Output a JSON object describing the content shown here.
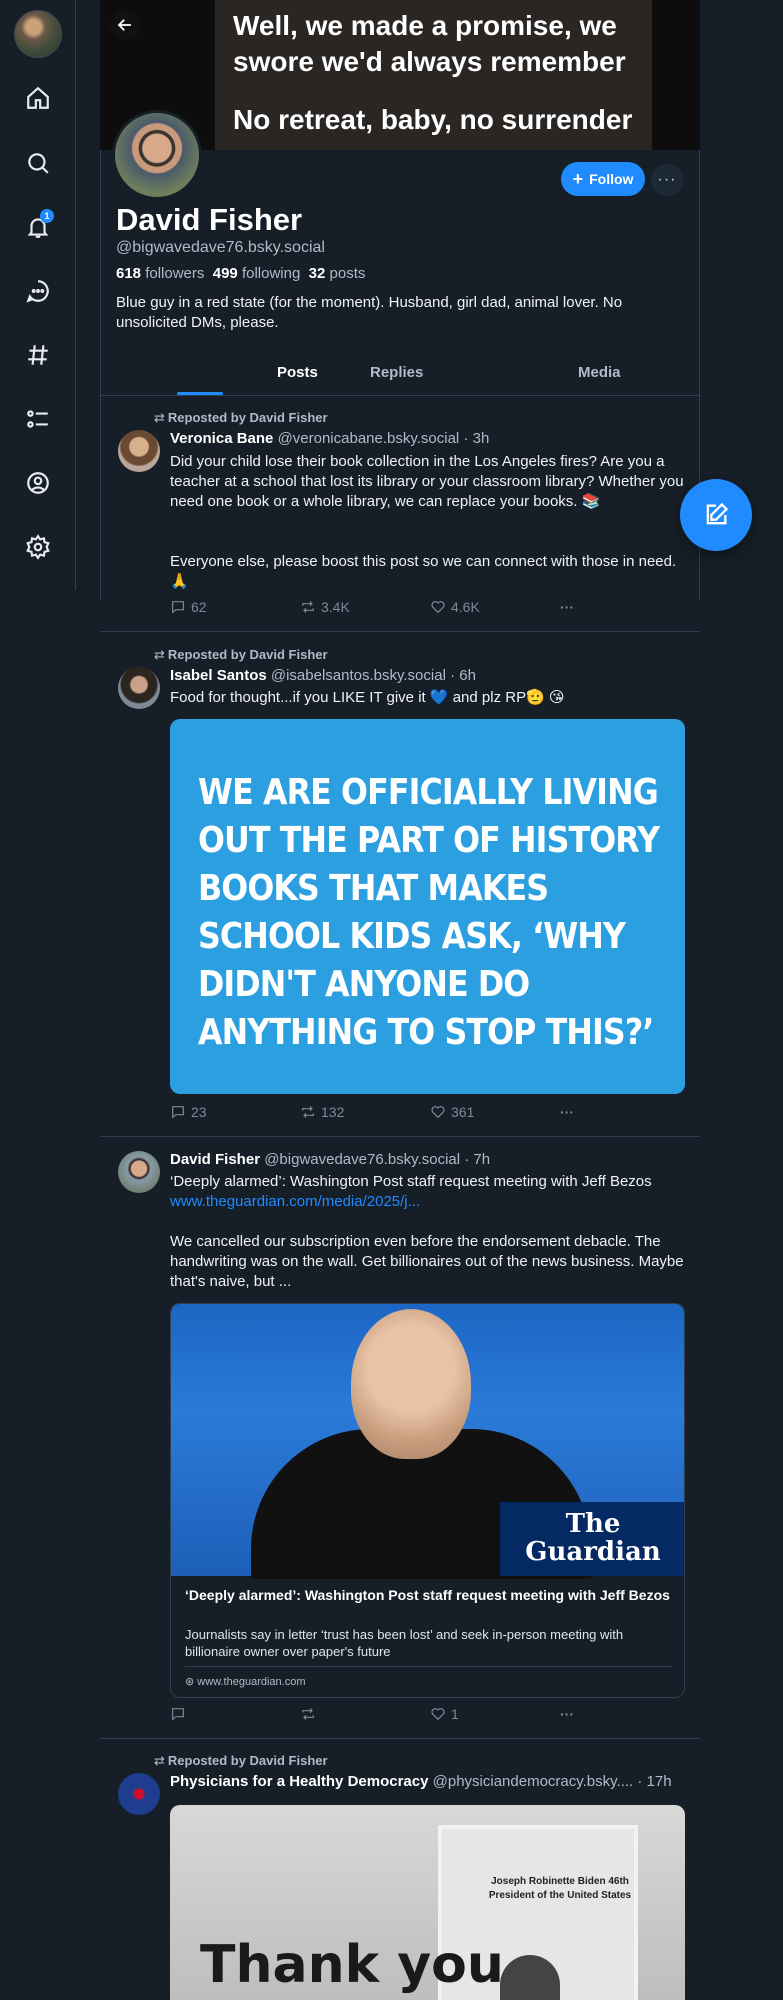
{
  "nav": {
    "notification_count": "1"
  },
  "banner": {
    "line1": "Well, we made a promise, we swore we'd always remember",
    "line2": "No retreat, baby, no surrender"
  },
  "profile": {
    "display_name": "David Fisher",
    "handle": "@bigwavedave76.bsky.social",
    "followers_count": "618",
    "followers_label": "followers",
    "following_count": "499",
    "following_label": "following",
    "posts_count": "32",
    "posts_label": "posts",
    "bio": "Blue guy in a red state (for the moment). Husband, girl dad, animal lover. No unsolicited DMs, please.",
    "follow_label": "Follow",
    "more_label": "···"
  },
  "tabs": [
    "Posts",
    "Replies",
    "Media"
  ],
  "posts": [
    {
      "repost_label": "Reposted by David Fisher",
      "author": "Veronica Bane",
      "handle": "@veronicabane.bsky.social",
      "time": "· 3h",
      "text1": "Did your child lose their book collection in the Los Angeles fires? Are you a teacher at a school that lost its library or your classroom library? Whether you need one book or a whole library, we can replace your books. 📚",
      "text2": "Everyone else, please boost this post so we can connect with those in need. 🙏",
      "replies": "62",
      "reposts": "3.4K",
      "likes": "4.6K"
    },
    {
      "repost_label": "Reposted by David Fisher",
      "author": "Isabel Santos",
      "handle": "@isabelsantos.bsky.social",
      "time": "· 6h",
      "text1": "Food for thought...if you LIKE IT give it 💙 and plz RP🫡 😘",
      "image_text": "WE ARE OFFICIALLY LIVING OUT THE PART OF HISTORY BOOKS THAT MAKES SCHOOL KIDS ASK, ‘WHY DIDN'T ANYONE DO ANYTHING TO STOP THIS?’",
      "replies": "23",
      "reposts": "132",
      "likes": "361"
    },
    {
      "author": "David Fisher",
      "handle": "@bigwavedave76.bsky.social",
      "time": "· 7h",
      "text1": "‘Deeply alarmed’: Washington Post staff request meeting with Jeff Bezos",
      "link": "www.theguardian.com/media/2025/j...",
      "text2": "We cancelled our subscription even before the endorsement debacle. The handwriting was on the wall. Get billionaires out of the news business. Maybe that's naive, but ...",
      "card_logo": "The Guardian",
      "card_title": "‘Deeply alarmed’: Washington Post staff request meeting with Jeff Bezos",
      "card_desc": "Journalists say in letter ‘trust has been lost’ and seek in-person meeting with billionaire owner over paper's future",
      "card_domain": "www.theguardian.com",
      "replies": "",
      "reposts": "",
      "likes": "1"
    },
    {
      "repost_label": "Reposted by David Fisher",
      "author": "Physicians for a Healthy Democracy",
      "handle": "@physiciandemocracy.bsky....",
      "time": "· 17h",
      "image_caption": "Joseph Robinette Biden 46th President of the United States",
      "image_text": "Thank you"
    }
  ],
  "colors": {
    "background": "#161e27",
    "accent": "#208bfe",
    "muted_text": "#aebbc9",
    "border": "#2e4052"
  }
}
